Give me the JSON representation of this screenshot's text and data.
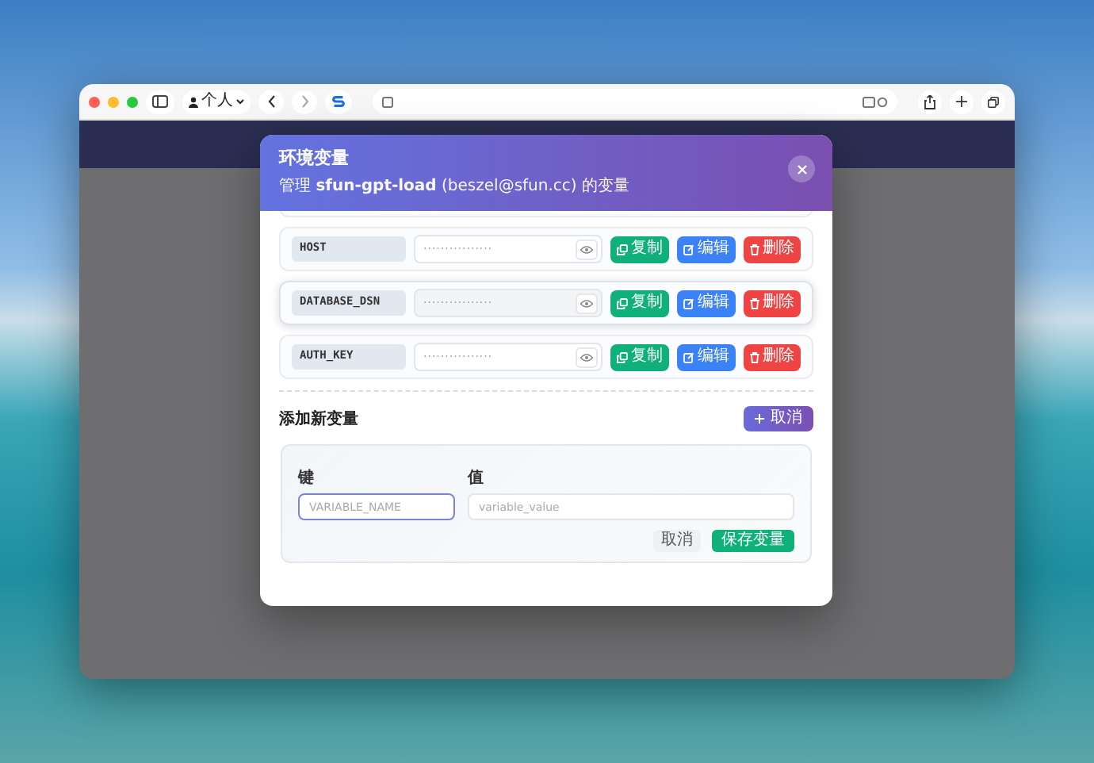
{
  "browser": {
    "profile_label": "个人"
  },
  "modal": {
    "title": "环境变量",
    "subtitle": "管理 **sfun-gpt-load** (beszel@sfun.cc) 的变量",
    "hidden_row_above": true,
    "variables": [
      {
        "key": "HOST",
        "masked_value": "················",
        "highlighted": false,
        "actions": [
          {
            "kind": "copy",
            "label": "复制"
          },
          {
            "kind": "edit",
            "label": "编辑"
          },
          {
            "kind": "delete",
            "label": "删除"
          }
        ]
      },
      {
        "key": "DATABASE_DSN",
        "masked_value": "················",
        "highlighted": true,
        "actions": [
          {
            "kind": "copy",
            "label": "复制"
          },
          {
            "kind": "edit",
            "label": "编辑"
          },
          {
            "kind": "delete",
            "label": "删除"
          }
        ]
      },
      {
        "key": "AUTH_KEY",
        "masked_value": "················",
        "highlighted": false,
        "actions": [
          {
            "kind": "copy",
            "label": "复制"
          },
          {
            "kind": "edit",
            "label": "编辑"
          },
          {
            "kind": "delete",
            "label": "删除"
          }
        ]
      }
    ],
    "add_section": {
      "title": "添加新变量",
      "toggle_button": "取消",
      "form": {
        "key_label": "键",
        "key_placeholder": "VARIABLE_NAME",
        "key_focused": true,
        "value_label": "值",
        "value_placeholder": "variable_value",
        "cancel_button": "取消",
        "save_button": "保存变量"
      }
    }
  }
}
